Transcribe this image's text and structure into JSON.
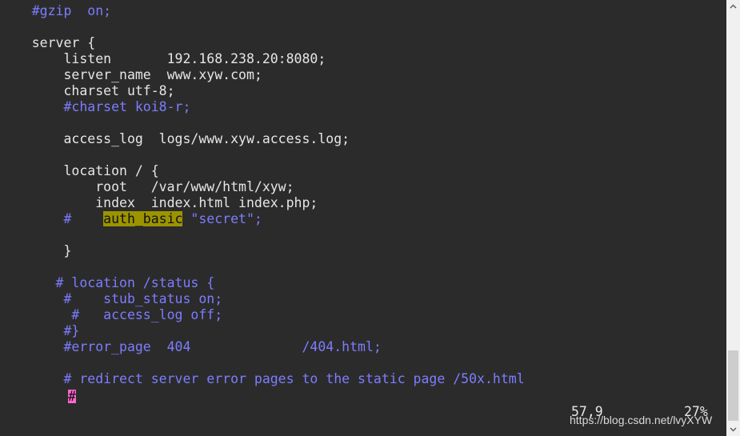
{
  "editor": {
    "lines": [
      {
        "segments": [
          {
            "text": "    #gzip  on;",
            "cls": "comment"
          }
        ]
      },
      {
        "segments": [
          {
            "text": "",
            "cls": "normal"
          }
        ]
      },
      {
        "segments": [
          {
            "text": "    server {",
            "cls": "normal"
          }
        ]
      },
      {
        "segments": [
          {
            "text": "        listen       192.168.238.20:8080;",
            "cls": "normal"
          }
        ]
      },
      {
        "segments": [
          {
            "text": "        server_name  www.xyw.com;",
            "cls": "normal"
          }
        ]
      },
      {
        "segments": [
          {
            "text": "        charset utf-8;",
            "cls": "normal"
          }
        ]
      },
      {
        "segments": [
          {
            "text": "        #charset koi8-r;",
            "cls": "comment"
          }
        ]
      },
      {
        "segments": [
          {
            "text": "",
            "cls": "normal"
          }
        ]
      },
      {
        "segments": [
          {
            "text": "        access_log  logs/www.xyw.access.log;",
            "cls": "normal"
          }
        ]
      },
      {
        "segments": [
          {
            "text": "",
            "cls": "normal"
          }
        ]
      },
      {
        "segments": [
          {
            "text": "        location / {",
            "cls": "normal"
          }
        ]
      },
      {
        "segments": [
          {
            "text": "            root   /var/www/html/xyw;",
            "cls": "normal"
          }
        ]
      },
      {
        "segments": [
          {
            "text": "            index  index.html index.php;",
            "cls": "normal"
          }
        ]
      },
      {
        "segments": [
          {
            "text": "        #    ",
            "cls": "comment"
          },
          {
            "text": "auth_basic",
            "cls": "hl"
          },
          {
            "text": " \"secret\";",
            "cls": "comment"
          }
        ]
      },
      {
        "segments": [
          {
            "text": "",
            "cls": "normal"
          }
        ]
      },
      {
        "segments": [
          {
            "text": "        }",
            "cls": "normal"
          }
        ]
      },
      {
        "segments": [
          {
            "text": "",
            "cls": "normal"
          }
        ]
      },
      {
        "segments": [
          {
            "text": "       # location /status {",
            "cls": "comment"
          }
        ]
      },
      {
        "segments": [
          {
            "text": "        #    stub_status on;",
            "cls": "comment"
          }
        ]
      },
      {
        "segments": [
          {
            "text": "         #   access_log off;",
            "cls": "comment"
          }
        ]
      },
      {
        "segments": [
          {
            "text": "        #}",
            "cls": "comment"
          }
        ]
      },
      {
        "segments": [
          {
            "text": "        #error_page  404              /404.html;",
            "cls": "comment"
          }
        ]
      },
      {
        "segments": [
          {
            "text": "",
            "cls": "normal"
          }
        ]
      },
      {
        "segments": [
          {
            "text": "        # redirect server error pages to the static page /50x.html",
            "cls": "comment"
          }
        ]
      },
      {
        "segments": [
          {
            "text": "",
            "cls": "normal"
          }
        ]
      }
    ],
    "cursor_char": "#"
  },
  "status": {
    "position": "57,9",
    "percent": "27%"
  },
  "watermark": {
    "text": "https://blog.csdn.net/lvyXYW"
  },
  "scrollbar": {
    "up_icon": "arrow-up-icon",
    "down_icon": "arrow-down-icon"
  },
  "colors": {
    "background": "#2b2b2b",
    "text": "#e6e6e6",
    "comment": "#7d7dff",
    "highlight": "#9b9400",
    "cursor": "#ff66cc"
  }
}
